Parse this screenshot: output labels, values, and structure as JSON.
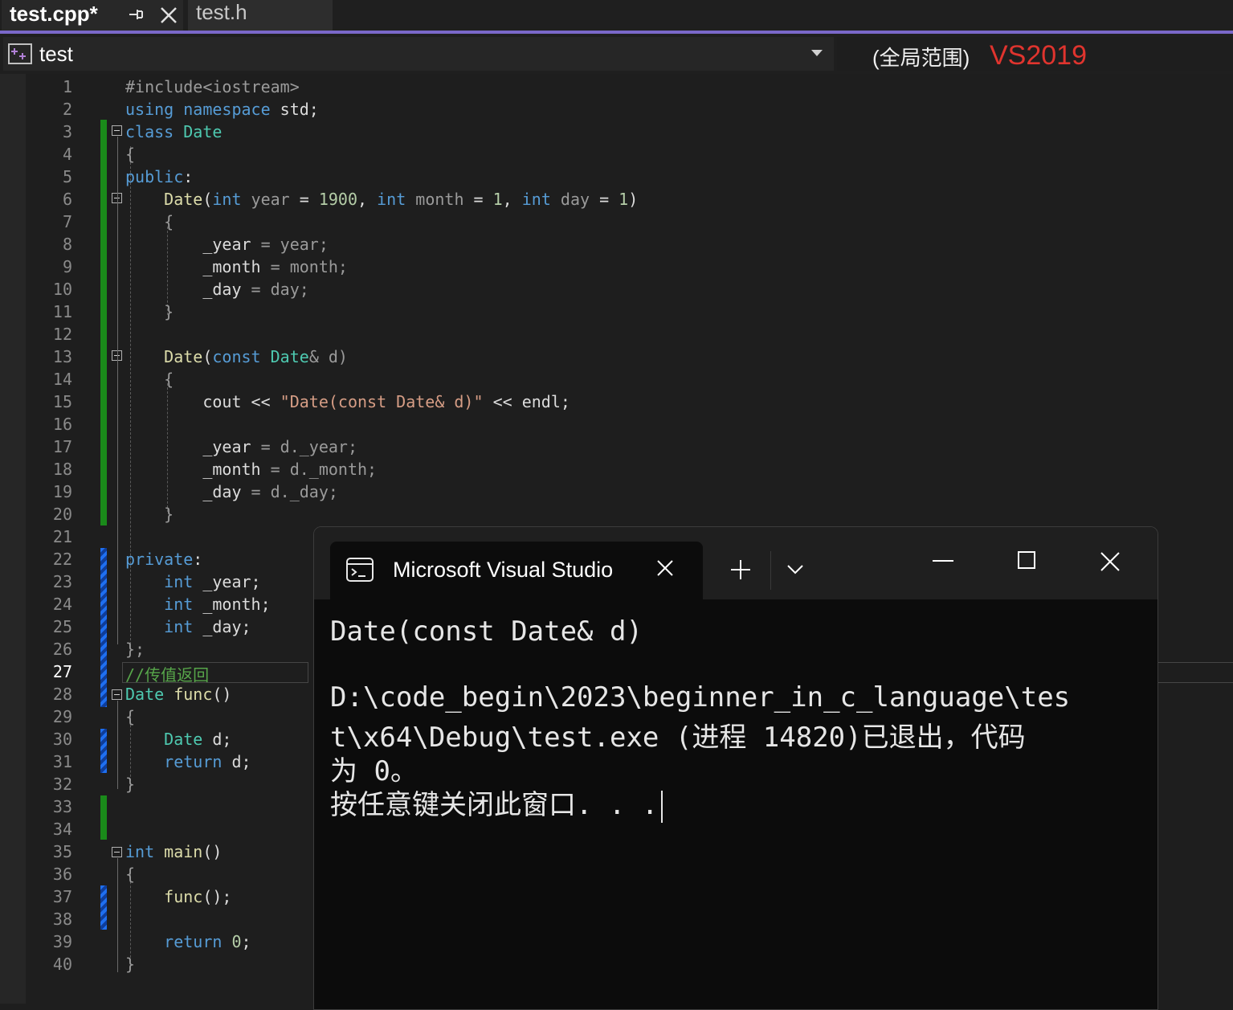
{
  "tabs": [
    {
      "label": "test.cpp*",
      "active": true
    },
    {
      "label": "test.h",
      "active": false
    }
  ],
  "nav": {
    "project": "test",
    "scope": "(全局范围)",
    "version_note": "VS2019"
  },
  "editor": {
    "current_line": 27,
    "line_numbers": [
      "1",
      "2",
      "3",
      "4",
      "5",
      "6",
      "7",
      "8",
      "9",
      "10",
      "11",
      "12",
      "13",
      "14",
      "15",
      "16",
      "17",
      "18",
      "19",
      "20",
      "21",
      "22",
      "23",
      "24",
      "25",
      "26",
      "27",
      "28",
      "29",
      "30",
      "31",
      "32",
      "33",
      "34",
      "35",
      "36",
      "37",
      "38",
      "39",
      "40"
    ],
    "code": {
      "l1": "#include<iostream>",
      "l2_kw": "using namespace",
      "l2_rest": " std;",
      "l3_kw": "class",
      "l3_ty": " Date",
      "l4": "{",
      "l5_kw": "public",
      "l5_rest": ":",
      "l6_fn": "    Date",
      "l6_a": "(",
      "l6_kw1": "int",
      "l6_v1": " year",
      "l6_b": " = ",
      "l6_n1": "1900",
      "l6_c": ", ",
      "l6_kw2": "int",
      "l6_v2": " month",
      "l6_d": " = ",
      "l6_n2": "1",
      "l6_e": ", ",
      "l6_kw3": "int",
      "l6_v3": " day",
      "l6_f": " = ",
      "l6_n3": "1",
      "l6_g": ")",
      "l7": "    {",
      "l8_m": "        _year",
      "l8_r": " = year;",
      "l9_m": "        _month",
      "l9_r": " = month;",
      "l10_m": "        _day",
      "l10_r": " = day;",
      "l11": "    }",
      "l13_fn": "    Date",
      "l13_a": "(",
      "l13_kw": "const",
      "l13_ty": " Date",
      "l13_r": "& d)",
      "l14": "    {",
      "l15_a": "        cout << ",
      "l15_str": "\"Date(const Date& d)\"",
      "l15_b": " << endl;",
      "l17_m": "        _year",
      "l17_r": " = d._year;",
      "l18_m": "        _month",
      "l18_r": " = d._month;",
      "l19_m": "        _day",
      "l19_r": " = d._day;",
      "l20": "    }",
      "l22_kw": "private",
      "l22_rest": ":",
      "l23_kw": "    int",
      "l23_r": " _year;",
      "l24_kw": "    int",
      "l24_r": " _month;",
      "l25_kw": "    int",
      "l25_r": " _day;",
      "l26": "};",
      "l27_cm": "//传值返回",
      "l28_ty": "Date",
      "l28_fn": " func",
      "l28_r": "()",
      "l29": "{",
      "l30_ty": "    Date",
      "l30_r": " d;",
      "l31_kw": "    return",
      "l31_r": " d;",
      "l32": "}",
      "l35_kw": "int",
      "l35_fn": " main",
      "l35_r": "()",
      "l36": "{",
      "l37_fn": "    func",
      "l37_r": "();",
      "l39_kw": "    return",
      "l39_sp": " ",
      "l39_n": "0",
      "l39_r": ";",
      "l40": "}"
    }
  },
  "console": {
    "title": "Microsoft Visual Studio",
    "lines": [
      "Date(const Date& d)",
      "",
      "D:\\code_begin\\2023\\beginner_in_c_language\\tes",
      "t\\x64\\Debug\\test.exe (进程 14820)已退出，代码",
      "为 0。",
      "按任意键关闭此窗口. . ."
    ]
  },
  "colors": {
    "accent": "#7a68c9",
    "keyword": "#569cd6",
    "type": "#4ec9b0",
    "function": "#dcdcaa",
    "comment": "#57a64a",
    "string": "#d69d85",
    "number": "#b5cea8",
    "version_note": "#e0342e",
    "change_saved": "#1a8a1a",
    "change_unsaved": "#1f6ff0"
  },
  "icons": {
    "tab_pin": "pin-icon",
    "tab_close": "close-icon",
    "project": "project-icon",
    "dropdown": "chevron-down-icon",
    "console": "cmd-icon",
    "new_tab": "plus-icon",
    "tab_menu": "chevron-down-icon",
    "minimize": "minimize-icon",
    "maximize": "maximize-icon",
    "close": "close-icon"
  }
}
